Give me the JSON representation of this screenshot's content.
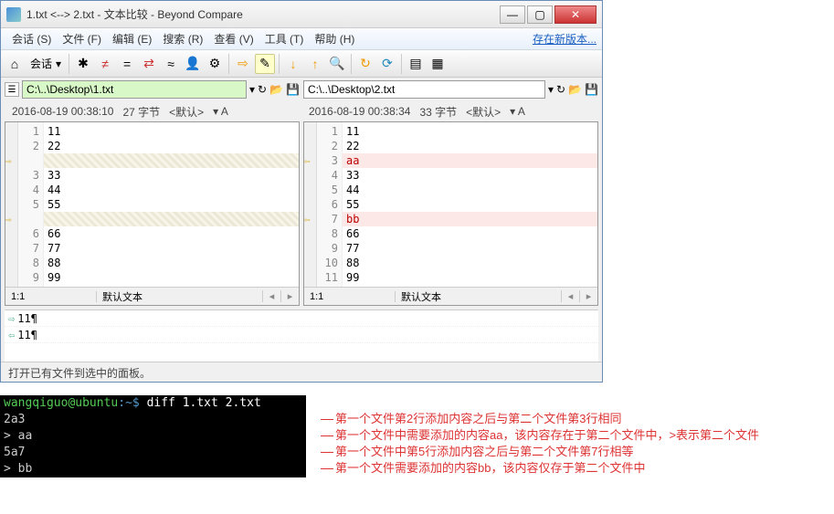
{
  "window": {
    "title": "1.txt <--> 2.txt - 文本比较 - Beyond Compare"
  },
  "menu": {
    "session": "会话 (S)",
    "file": "文件 (F)",
    "edit": "编辑 (E)",
    "search": "搜索 (R)",
    "view": "查看 (V)",
    "tools": "工具 (T)",
    "help": "帮助 (H)",
    "update": "存在新版本..."
  },
  "toolbar": {
    "session_btn": "会话"
  },
  "paths": {
    "left": "C:\\..\\Desktop\\1.txt",
    "right": "C:\\..\\Desktop\\2.txt"
  },
  "info": {
    "left_date": "2016-08-19 00:38:10",
    "left_bytes": "27 字节",
    "left_enc": "<默认>",
    "left_arrow": "▾ A",
    "right_date": "2016-08-19 00:38:34",
    "right_bytes": "33 字节",
    "right_enc": "<默认>",
    "right_arrow": "▾ A"
  },
  "left_lines": [
    {
      "n": "1",
      "t": "11",
      "cls": ""
    },
    {
      "n": "2",
      "t": "22",
      "cls": ""
    },
    {
      "n": "",
      "t": "",
      "cls": "diff",
      "arrow": "⇨"
    },
    {
      "n": "3",
      "t": "33",
      "cls": ""
    },
    {
      "n": "4",
      "t": "44",
      "cls": ""
    },
    {
      "n": "5",
      "t": "55",
      "cls": ""
    },
    {
      "n": "",
      "t": "",
      "cls": "diff",
      "arrow": "⇨"
    },
    {
      "n": "6",
      "t": "66",
      "cls": ""
    },
    {
      "n": "7",
      "t": "77",
      "cls": ""
    },
    {
      "n": "8",
      "t": "88",
      "cls": ""
    },
    {
      "n": "9",
      "t": "99",
      "cls": ""
    }
  ],
  "right_lines": [
    {
      "n": "1",
      "t": "11",
      "cls": ""
    },
    {
      "n": "2",
      "t": "22",
      "cls": ""
    },
    {
      "n": "3",
      "t": "aa",
      "cls": "diffR",
      "arrow": "⇦"
    },
    {
      "n": "4",
      "t": "33",
      "cls": ""
    },
    {
      "n": "5",
      "t": "44",
      "cls": ""
    },
    {
      "n": "6",
      "t": "55",
      "cls": ""
    },
    {
      "n": "7",
      "t": "bb",
      "cls": "diffR",
      "arrow": "⇦"
    },
    {
      "n": "8",
      "t": "66",
      "cls": ""
    },
    {
      "n": "9",
      "t": "77",
      "cls": ""
    },
    {
      "n": "10",
      "t": "88",
      "cls": ""
    },
    {
      "n": "11",
      "t": "99",
      "cls": ""
    }
  ],
  "panefoot": {
    "left_pos": "1:1",
    "right_pos": "1:1",
    "enc_label": "默认文本",
    "nav_prev": "◂",
    "nav_next": "▸"
  },
  "split": {
    "line1": "11¶",
    "line2": "11¶",
    "arrow1": "⇨",
    "arrow2": "⇦"
  },
  "status": "打开已有文件到选中的面板。",
  "terminal": {
    "prompt_user": "wangqiguo",
    "prompt_host": "@ubuntu",
    "prompt_path": ":~$ ",
    "cmd": "diff 1.txt 2.txt",
    "out1": "2a3",
    "out2": "> aa",
    "out3": "5a7",
    "out4": "> bb"
  },
  "annotations": {
    "a1": "第一个文件第2行添加内容之后与第二个文件第3行相同",
    "a2": "第一个文件中需要添加的内容aa，该内容存在于第二个文件中，>表示第二个文件",
    "a3": "第一个文件中第5行添加内容之后与第二个文件第7行相等",
    "a4": "第一个文件需要添加的内容bb，该内容仅存于第二个文件中"
  }
}
